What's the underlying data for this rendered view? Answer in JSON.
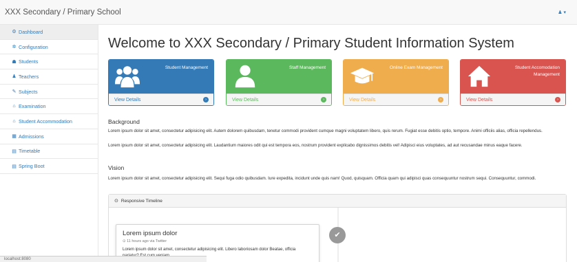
{
  "navbar": {
    "brand": "XXX Secondary / Primary School",
    "user_icon": "user-icon",
    "caret": "▾"
  },
  "sidebar": {
    "items": [
      {
        "label": "Dashboard",
        "icon": "dashboard-icon",
        "glyph": "⚙"
      },
      {
        "label": "Configuration",
        "icon": "cogs-icon",
        "glyph": "✲"
      },
      {
        "label": "Students",
        "icon": "users-icon",
        "glyph": "☗"
      },
      {
        "label": "Teachers",
        "icon": "user-icon",
        "glyph": "♟"
      },
      {
        "label": "Subjects",
        "icon": "book-icon",
        "glyph": "✎"
      },
      {
        "label": "Examination",
        "icon": "graduation-cap-icon",
        "glyph": "⌂"
      },
      {
        "label": "Student Accommodation",
        "icon": "home-icon",
        "glyph": "⌂"
      },
      {
        "label": "Admissions",
        "icon": "table-icon",
        "glyph": "▦"
      },
      {
        "label": "Timetable",
        "icon": "calendar-icon",
        "glyph": "▤"
      },
      {
        "label": "Spring Boot",
        "icon": "calendar-icon",
        "glyph": "▤"
      }
    ]
  },
  "main": {
    "title": "Welcome to XXX Secondary / Primary Student Information System",
    "cards": [
      {
        "title": "Student Management",
        "footer": "View Details",
        "color": "#337ab7",
        "icon": "users-icon"
      },
      {
        "title": "Staff Management",
        "footer": "View Details",
        "color": "#5cb85c",
        "icon": "user-icon"
      },
      {
        "title": "Online Exam Management",
        "footer": "View Details",
        "color": "#f0ad4e",
        "icon": "graduation-cap-icon"
      },
      {
        "title": "Student Accomodation Management",
        "footer": "View Details",
        "color": "#d9534f",
        "icon": "home-icon"
      }
    ],
    "background": {
      "heading": "Background",
      "p1": "Lorem ipsum dolor sit amet, consectetur adipisicing elit. Autem dolorem quibusdam, tenetur commodi provident cumque magni voluptatem libero, quis rerum. Fugiat esse debitis optio, tempore. Animi officiis alias, officia repellendus.",
      "p2": "Lorem ipsum dolor sit amet, consectetur adipisicing elit. Laudantium maiores odit qui est tempora eos, nostrum provident explicabo dignissimos debitis vel! Adipisci eius voluptates, ad aut recusandae minus eaque facere."
    },
    "vision": {
      "heading": "Vision",
      "p1": "Lorem ipsum dolor sit amet, consectetur adipisicing elit. Sequi fuga odio quibusdam. Iure expedita, incidunt unde quis nam! Quod, quisquam. Officia quam qui adipisci quas consequuntur nostrum sequi. Consequuntur, commodi."
    },
    "timeline": {
      "heading": "Responsive Timeline",
      "item_title": "Lorem ipsum dolor",
      "item_meta": "11 hours ago via Twitter",
      "item_body": "Lorem ipsum dolor sit amet, consectetur adipisicing elit. Libero laboriosam dolor Beatae, officia pariatur? Est cum veniam"
    }
  },
  "status_bar": {
    "text": "localhost:8080"
  }
}
